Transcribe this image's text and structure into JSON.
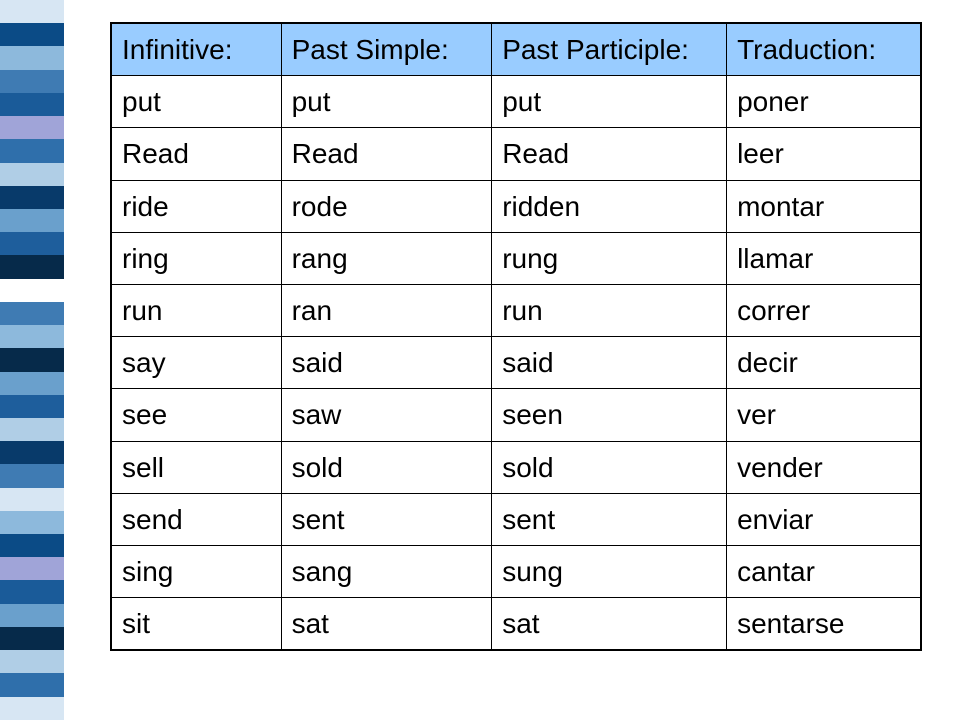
{
  "stripes": [
    "#d7e6f3",
    "#0b4b86",
    "#8db9dc",
    "#3f7bb3",
    "#1a5b99",
    "#a0a4d8",
    "#2f6fab",
    "#b0cee6",
    "#083a6a",
    "#6aa0cc",
    "#1e5e9c",
    "#062a4a",
    "#ffffff",
    "#3f7bb3",
    "#8db9dc",
    "#062a4a",
    "#6aa0cc",
    "#1e5e9c",
    "#b0cee6",
    "#083a6a",
    "#3f7bb3",
    "#d7e6f3",
    "#8db9dc",
    "#0b4b86",
    "#a0a4d8",
    "#1a5b99",
    "#6aa0cc",
    "#062a4a",
    "#b0cee6",
    "#2f6fab",
    "#d7e6f3"
  ],
  "headers": [
    "Infinitive:",
    "Past Simple:",
    "Past Participle:",
    "Traduction:"
  ],
  "rows": [
    [
      "put",
      "put",
      "put",
      "poner"
    ],
    [
      "Read",
      "Read",
      "Read",
      "leer"
    ],
    [
      "ride",
      "rode",
      "ridden",
      "montar"
    ],
    [
      "ring",
      "rang",
      "rung",
      "llamar"
    ],
    [
      "run",
      "ran",
      "run",
      "correr"
    ],
    [
      "say",
      "said",
      "said",
      "decir"
    ],
    [
      "see",
      "saw",
      "seen",
      "ver"
    ],
    [
      "sell",
      "sold",
      "sold",
      "vender"
    ],
    [
      "send",
      "sent",
      "sent",
      "enviar"
    ],
    [
      "sing",
      "sang",
      "sung",
      "cantar"
    ],
    [
      "sit",
      "sat",
      "sat",
      "sentarse"
    ]
  ]
}
